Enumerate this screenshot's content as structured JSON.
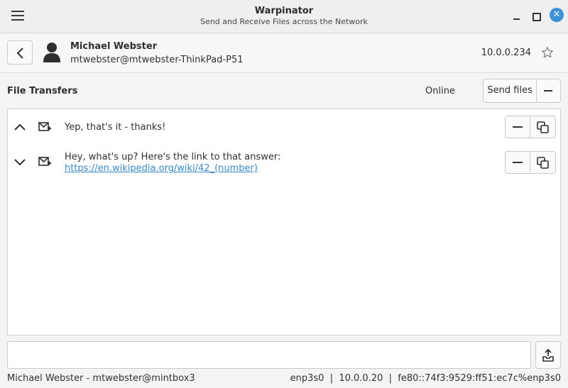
{
  "window": {
    "title": "Warpinator",
    "subtitle": "Send and Receive Files across the Network",
    "close_glyph": "✕"
  },
  "remote": {
    "name": "Michael Webster",
    "host": "mtwebster@mtwebster-ThinkPad-P51",
    "ip": "10.0.0.234",
    "favorite": false
  },
  "section": {
    "title": "File Transfers",
    "status": "Online",
    "send_label": "Send files"
  },
  "messages": [
    {
      "text": "Yep, that's it - thanks!",
      "expanded": true,
      "expand_icon": "chevron-up-icon"
    },
    {
      "text": "Hey, what's up? Here's the link to that answer:",
      "link": "https://en.wikipedia.org/wiki/42_(number)",
      "expanded": false,
      "expand_icon": "chevron-down-icon"
    }
  ],
  "compose": {
    "value": "",
    "placeholder": ""
  },
  "statusbar": {
    "local_user": "Michael Webster - mtwebster@mintbox3",
    "interface": "enp3s0",
    "ipv4": "10.0.0.20",
    "ipv6": "fe80::74f3:9529:ff51:ec7c%enp3s0",
    "network_info": "enp3s0  |  10.0.0.20  |  fe80::74f3:9529:ff51:ec7c%enp3s0"
  },
  "colors": {
    "accent": "#3d91d4",
    "link": "#3b87c8"
  }
}
